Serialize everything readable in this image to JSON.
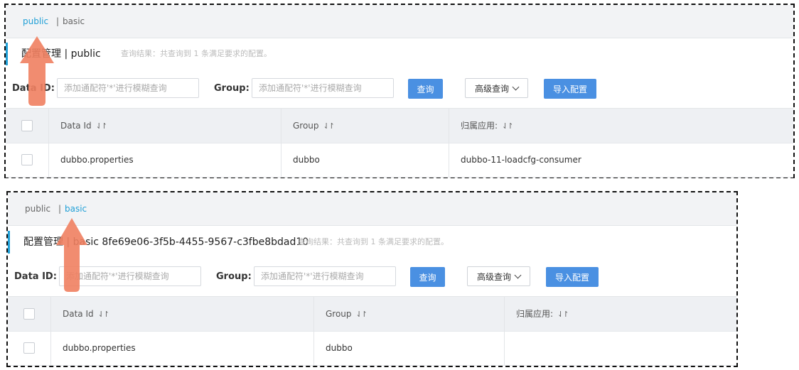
{
  "colors": {
    "accent": "#1f9fd6",
    "primary_button": "#4a90e2",
    "annotation_arrow": "#f08060"
  },
  "panels": [
    {
      "namespaces": [
        {
          "label": "public",
          "active": true
        },
        {
          "label": "basic",
          "active": false
        }
      ],
      "separator": "|",
      "title": "配置管理  |  public",
      "result": "查询结果：共查询到 1 条满足要求的配置。",
      "search": {
        "data_id_label": "Data ID:",
        "data_id_placeholder": "添加通配符'*'进行模糊查询",
        "group_label": "Group:",
        "group_placeholder": "添加通配符'*'进行模糊查询",
        "query_button": "查询",
        "advanced_button": "高级查询",
        "import_button": "导入配置"
      },
      "table": {
        "headers": [
          "Data Id",
          "Group",
          "归属应用:"
        ],
        "sort_icon": "⇃↾",
        "rows": [
          [
            "dubbo.properties",
            "dubbo",
            "dubbo-11-loadcfg-consumer"
          ]
        ]
      }
    },
    {
      "namespaces": [
        {
          "label": "public",
          "active": false
        },
        {
          "label": "basic",
          "active": true
        }
      ],
      "separator": "|",
      "title": "配置管理  |  basic  8fe69e06-3f5b-4455-9567-c3fbe8bdad10",
      "result": "查询结果：共查询到 1 条满足要求的配置。",
      "search": {
        "data_id_label": "Data ID:",
        "data_id_placeholder": "添加通配符'*'进行模糊查询",
        "group_label": "Group:",
        "group_placeholder": "添加通配符'*'进行模糊查询",
        "query_button": "查询",
        "advanced_button": "高级查询",
        "import_button": "导入配置"
      },
      "table": {
        "headers": [
          "Data Id",
          "Group",
          "归属应用:"
        ],
        "sort_icon": "⇃↾",
        "rows": [
          [
            "dubbo.properties",
            "dubbo",
            ""
          ]
        ]
      }
    }
  ]
}
